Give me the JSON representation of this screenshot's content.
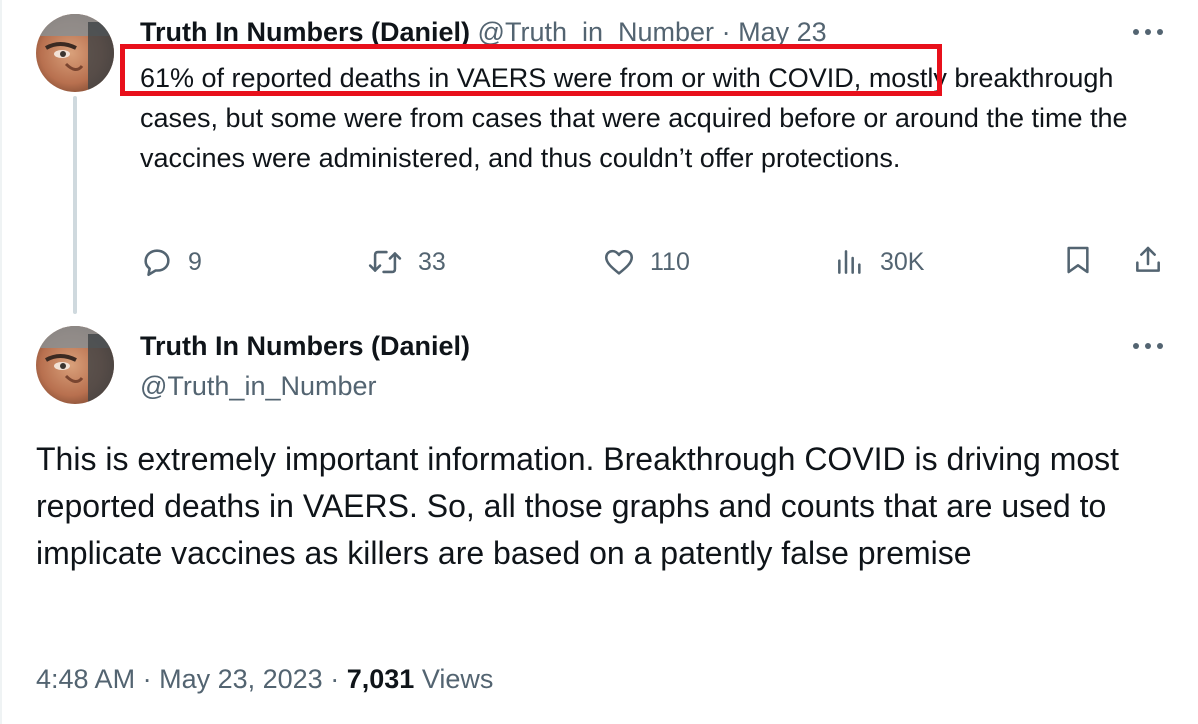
{
  "reply_tweet": {
    "author_name": "Truth In Numbers (Daniel)",
    "handle": "@Truth_in_Number",
    "separator": "·",
    "date": "May 23",
    "highlighted_text": "61% of reported deaths in VAERS were from or with COVID,",
    "body_rest": " mostly breakthrough cases, but some were from cases that were acquired before or around the time the vaccines were administered, and thus couldn’t offer protections.",
    "actions": {
      "replies": "9",
      "reposts": "33",
      "likes": "110",
      "views": "30K"
    },
    "more_icon": "more-horizontal-icon"
  },
  "main_tweet": {
    "author_name": "Truth In Numbers (Daniel)",
    "handle": "@Truth_in_Number",
    "body": "This is extremely important information. Breakthrough COVID is driving most reported deaths in VAERS. So, all those graphs and counts that are used to implicate vaccines as killers are based on a patently false premise",
    "time": "4:48 AM",
    "date": "May 23, 2023",
    "separator": "·",
    "views_count": "7,031",
    "views_label": "Views",
    "more_icon": "more-horizontal-icon"
  },
  "colors": {
    "text": "#0f1419",
    "muted": "#536471",
    "highlight_border": "#e8101b",
    "thread_line": "#cfd9de"
  }
}
